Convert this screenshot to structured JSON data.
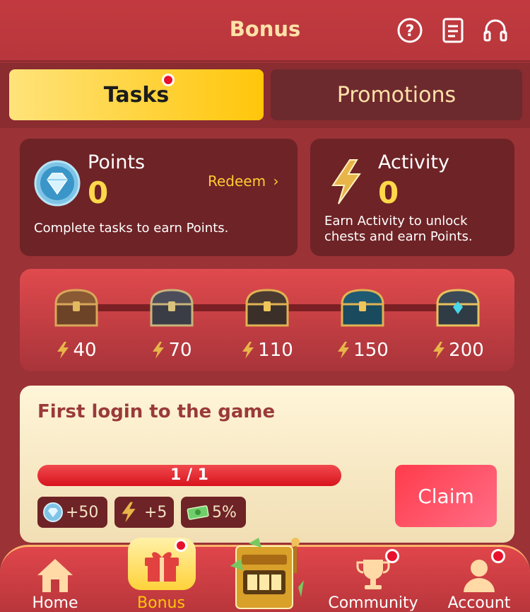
{
  "header": {
    "title": "Bonus",
    "icons": [
      "help-icon",
      "document-icon",
      "headset-icon"
    ]
  },
  "tabs": [
    {
      "label": "Tasks",
      "active": true
    },
    {
      "label": "Promotions",
      "active": false
    }
  ],
  "points_card": {
    "label": "Points",
    "value": "0",
    "redeem_label": "Redeem",
    "description": "Complete tasks to earn Points."
  },
  "activity_card": {
    "label": "Activity",
    "value": "0",
    "description_line1": "Earn Activity to unlock",
    "description_line2": "chests and earn Points."
  },
  "chests": [
    {
      "cost": "40"
    },
    {
      "cost": "70"
    },
    {
      "cost": "110"
    },
    {
      "cost": "150"
    },
    {
      "cost": "200"
    }
  ],
  "task": {
    "title": "First login to the game",
    "progress_text": "1 / 1",
    "progress_fraction": 1.0,
    "rewards": [
      "+50",
      "+5",
      "5%"
    ],
    "claim_label": "Claim"
  },
  "nav": {
    "items": [
      {
        "label": "Home"
      },
      {
        "label": "Bonus",
        "active": true
      },
      {
        "label": "Community"
      },
      {
        "label": "Account"
      }
    ]
  },
  "colors": {
    "background": "#9a3236",
    "accent_yellow": "#ffc60a",
    "accent_gold_text": "#ffcc33",
    "card_dark": "#6e2326",
    "claim_pink": "#ff4d66"
  }
}
